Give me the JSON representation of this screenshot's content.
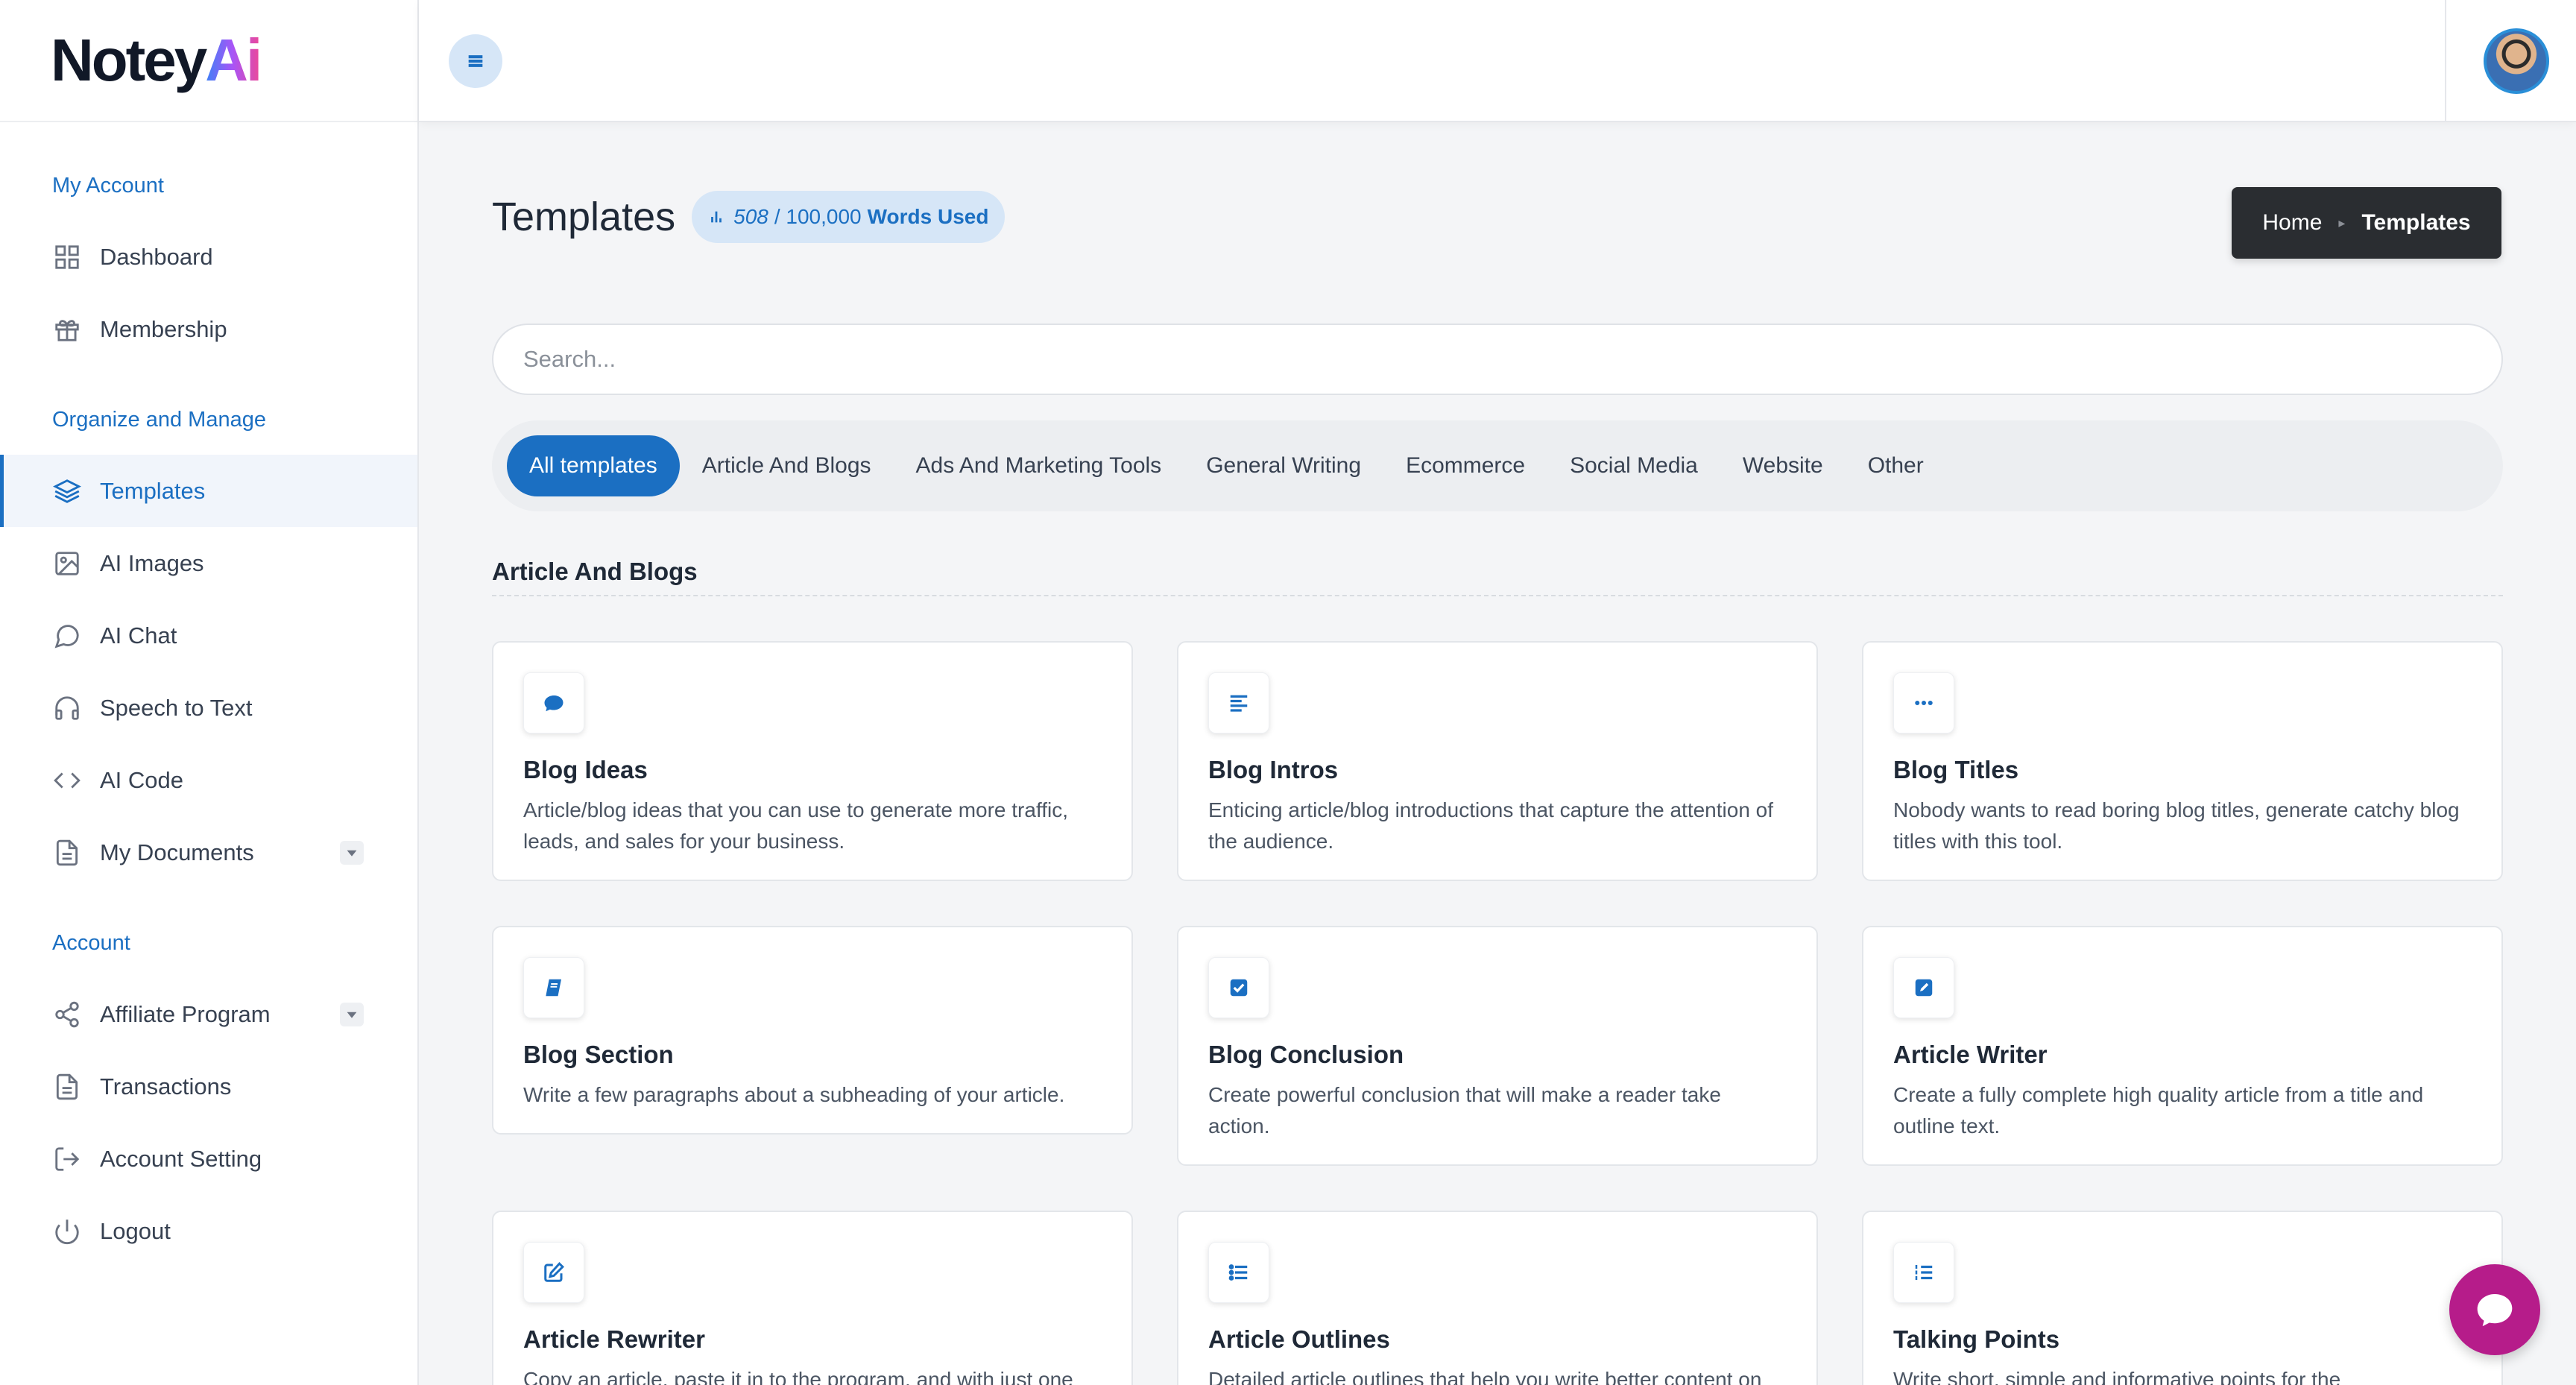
{
  "brand": {
    "logo_main": "Notey",
    "logo_ai": "Ai"
  },
  "sidebar": {
    "sections": [
      {
        "title": "My Account",
        "items": [
          {
            "label": "Dashboard",
            "icon": "grid-icon"
          },
          {
            "label": "Membership",
            "icon": "gift-icon"
          }
        ]
      },
      {
        "title": "Organize and Manage",
        "items": [
          {
            "label": "Templates",
            "icon": "layers-icon",
            "active": true
          },
          {
            "label": "AI Images",
            "icon": "image-icon"
          },
          {
            "label": "AI Chat",
            "icon": "chat-bubble-icon"
          },
          {
            "label": "Speech to Text",
            "icon": "headphones-icon"
          },
          {
            "label": "AI Code",
            "icon": "code-icon"
          },
          {
            "label": "My Documents",
            "icon": "document-icon",
            "expandable": true
          }
        ]
      },
      {
        "title": "Account",
        "items": [
          {
            "label": "Affiliate Program",
            "icon": "share-icon",
            "expandable": true
          },
          {
            "label": "Transactions",
            "icon": "document-icon"
          },
          {
            "label": "Account Setting",
            "icon": "logout-arrow-icon"
          },
          {
            "label": "Logout",
            "icon": "power-icon"
          }
        ]
      }
    ]
  },
  "header": {
    "title": "Templates",
    "words_used": "508",
    "words_total": "/ 100,000",
    "words_label": "Words Used"
  },
  "breadcrumb": {
    "home": "Home",
    "current": "Templates"
  },
  "search": {
    "placeholder": "Search..."
  },
  "filters": [
    "All templates",
    "Article And Blogs",
    "Ads And Marketing Tools",
    "General Writing",
    "Ecommerce",
    "Social Media",
    "Website",
    "Other"
  ],
  "group": {
    "title": "Article And Blogs"
  },
  "cards": [
    {
      "title": "Blog Ideas",
      "desc": "Article/blog ideas that you can use to generate more traffic, leads, and sales for your business.",
      "icon": "comment-icon"
    },
    {
      "title": "Blog Intros",
      "desc": "Enticing article/blog introductions that capture the attention of the audience.",
      "icon": "align-left-icon"
    },
    {
      "title": "Blog Titles",
      "desc": "Nobody wants to read boring blog titles, generate catchy blog titles with this tool.",
      "icon": "ellipsis-icon"
    },
    {
      "title": "Blog Section",
      "desc": "Write a few paragraphs about a subheading of your article.",
      "icon": "book-icon"
    },
    {
      "title": "Blog Conclusion",
      "desc": "Create powerful conclusion that will make a reader take action.",
      "icon": "check-square-icon"
    },
    {
      "title": "Article Writer",
      "desc": "Create a fully complete high quality article from a title and outline text.",
      "icon": "pen-square-icon"
    },
    {
      "title": "Article Rewriter",
      "desc": "Copy an article, paste it in to the program, and with just one",
      "icon": "edit-icon"
    },
    {
      "title": "Article Outlines",
      "desc": "Detailed article outlines that help you write better content on",
      "icon": "list-icon"
    },
    {
      "title": "Talking Points",
      "desc": "Write short, simple and informative points for the",
      "icon": "ordered-list-icon"
    }
  ],
  "colors": {
    "accent": "#1b6fc2",
    "chat_fab": "#b61c8a",
    "breadcrumb_bg": "#2a2d31"
  }
}
